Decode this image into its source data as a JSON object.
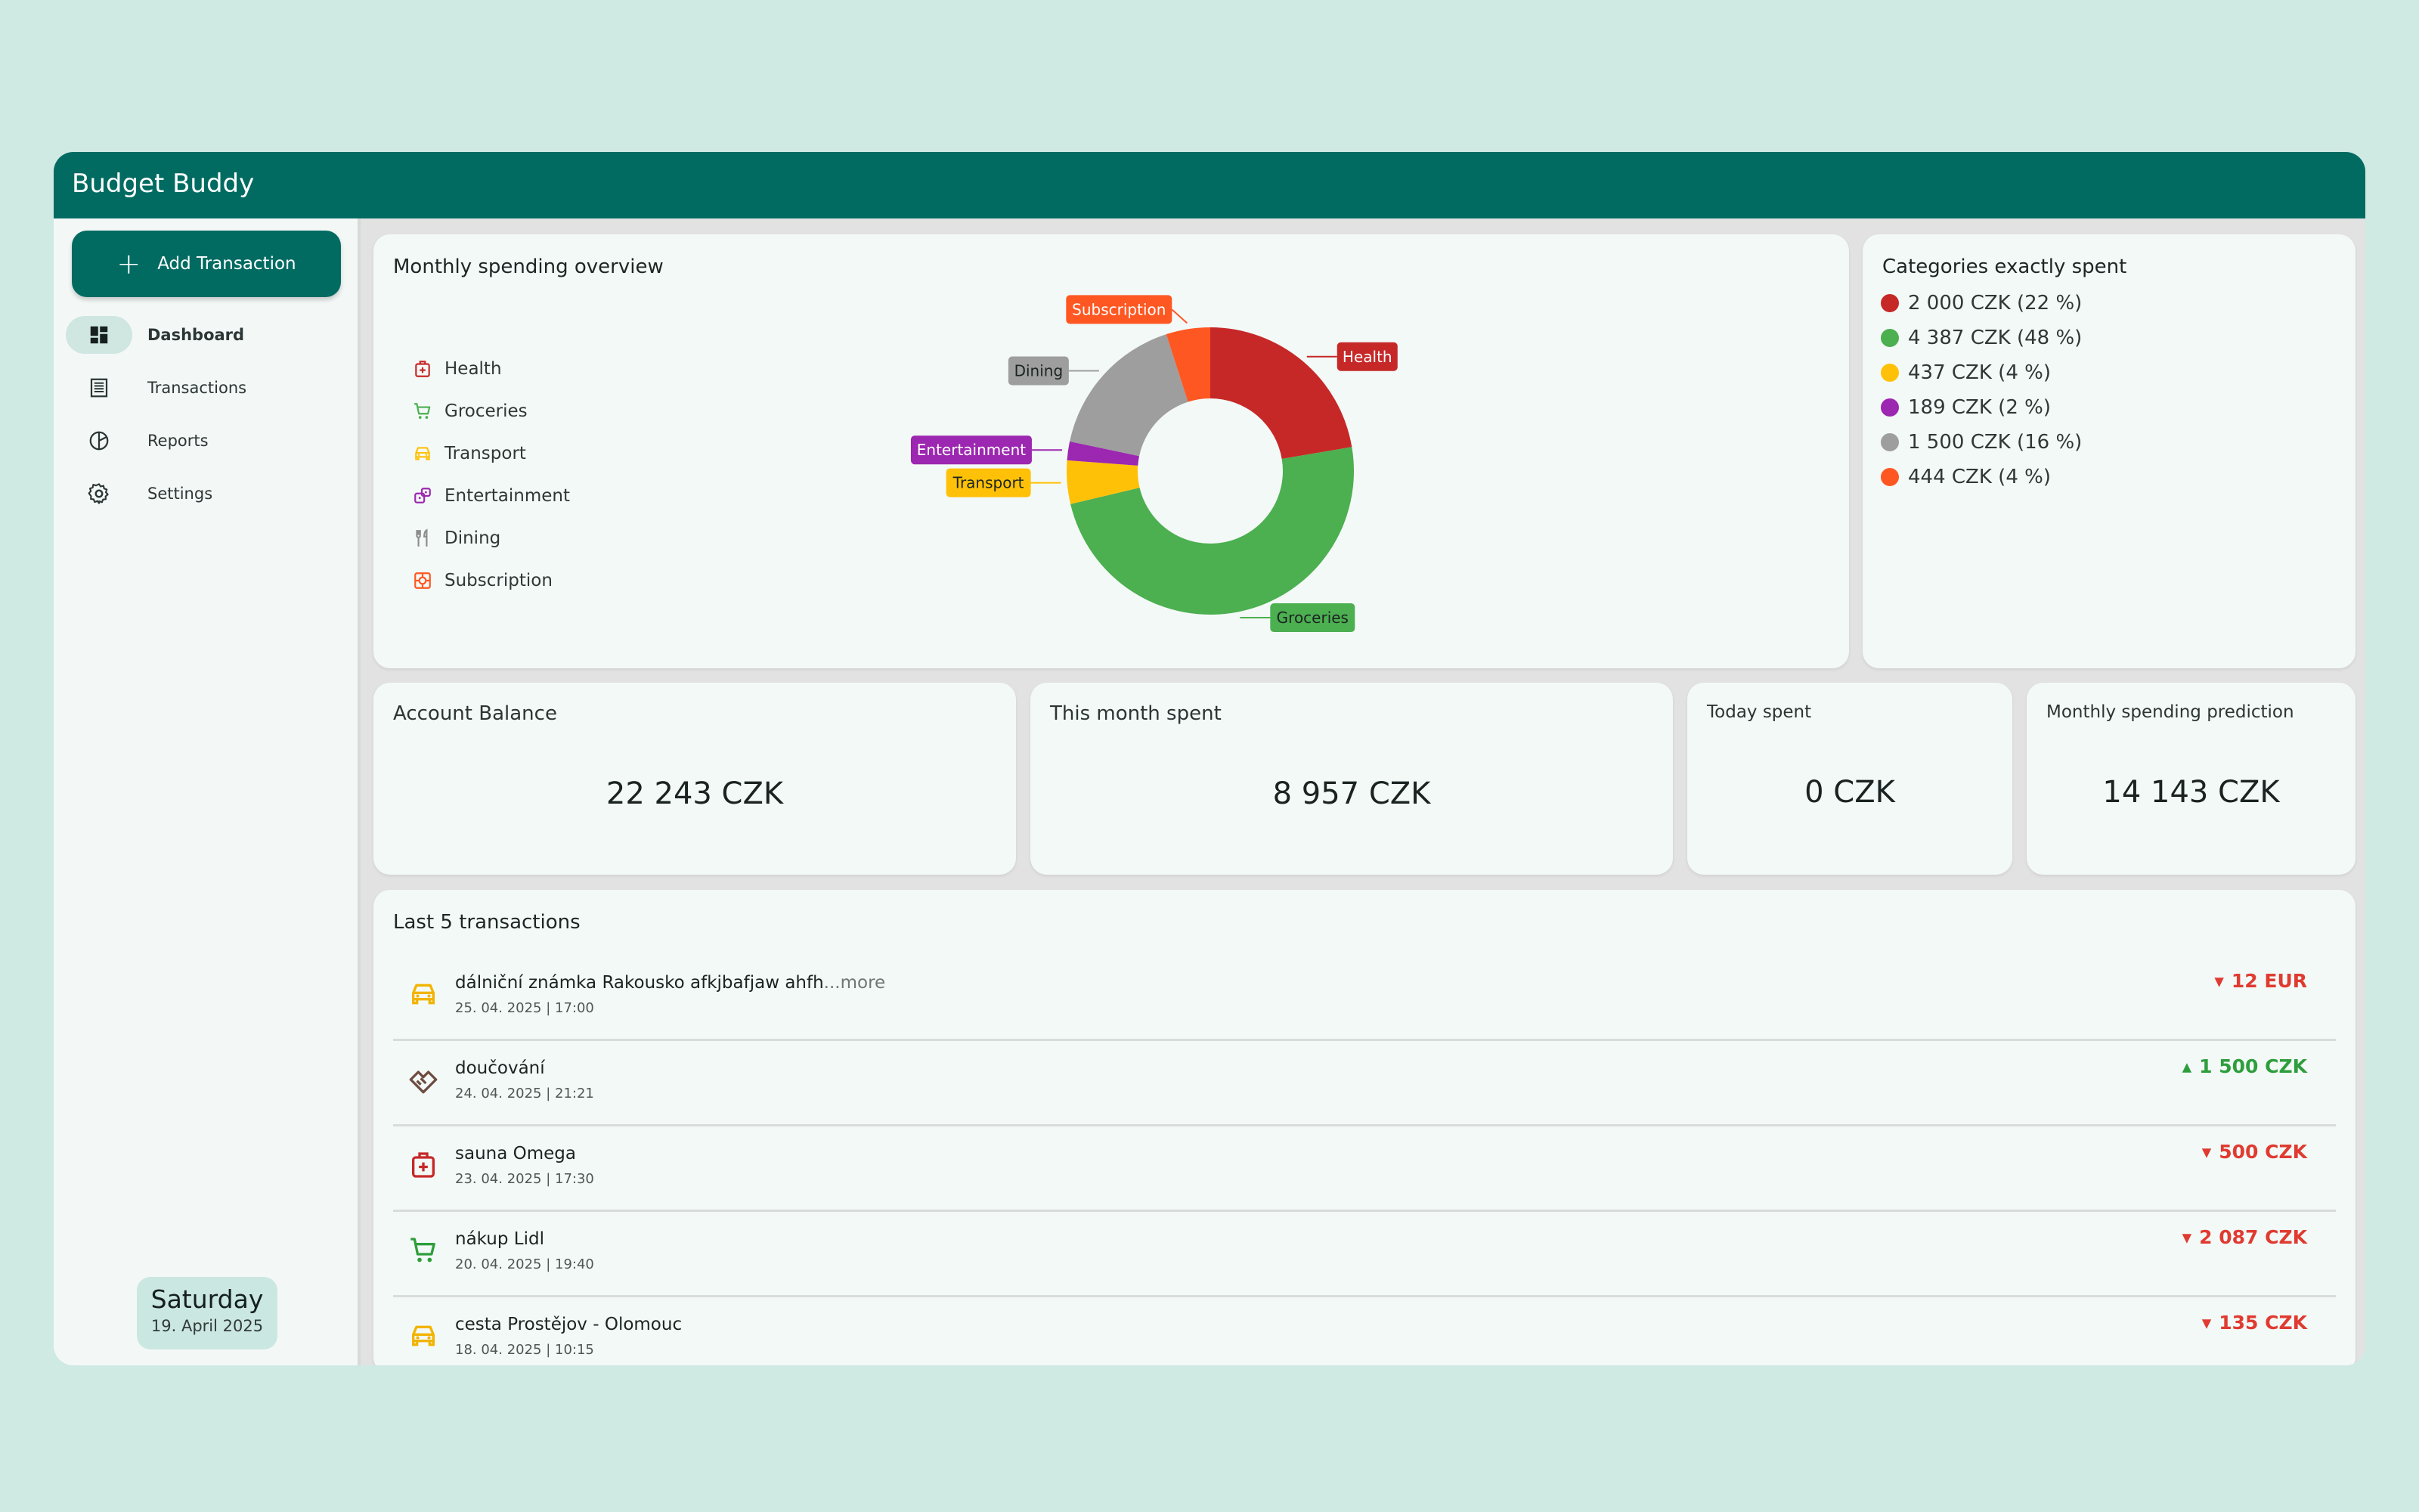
{
  "app": {
    "title": "Budget Buddy"
  },
  "sidebar": {
    "add_label": "Add Transaction",
    "items": [
      {
        "label": "Dashboard",
        "icon": "dashboard-icon",
        "active": true
      },
      {
        "label": "Transactions",
        "icon": "list-icon",
        "active": false
      },
      {
        "label": "Reports",
        "icon": "pie-chart-icon",
        "active": false
      },
      {
        "label": "Settings",
        "icon": "gear-icon",
        "active": false
      }
    ],
    "date": {
      "day": "Saturday",
      "date": "19. April 2025"
    }
  },
  "overview": {
    "title": "Monthly spending overview",
    "legend": [
      {
        "label": "Health",
        "icon": "medical-bag-icon",
        "color": "#c62828"
      },
      {
        "label": "Groceries",
        "icon": "cart-icon",
        "color": "#4caf50"
      },
      {
        "label": "Transport",
        "icon": "car-icon",
        "color": "#ffc107"
      },
      {
        "label": "Entertainment",
        "icon": "gamepad-icon",
        "color": "#9c27b0"
      },
      {
        "label": "Dining",
        "icon": "fork-knife-icon",
        "color": "#9e9e9e"
      },
      {
        "label": "Subscription",
        "icon": "subscription-icon",
        "color": "#ff5722"
      }
    ]
  },
  "chart_data": {
    "type": "pie",
    "donut": true,
    "title": "Monthly spending overview",
    "categories": [
      "Health",
      "Groceries",
      "Transport",
      "Entertainment",
      "Dining",
      "Subscription"
    ],
    "values": [
      2000,
      4387,
      437,
      189,
      1500,
      444
    ],
    "colors": [
      "#c62828",
      "#4caf50",
      "#ffc107",
      "#9c27b0",
      "#9e9e9e",
      "#ff5722"
    ]
  },
  "categories_card": {
    "title": "Categories exactly spent",
    "rows": [
      {
        "text": "2 000 CZK (22 %)",
        "color": "#c62828"
      },
      {
        "text": "4 387 CZK (48 %)",
        "color": "#4caf50"
      },
      {
        "text": "437 CZK (4 %)",
        "color": "#ffc107"
      },
      {
        "text": "189 CZK (2 %)",
        "color": "#9c27b0"
      },
      {
        "text": "1 500 CZK (16 %)",
        "color": "#9e9e9e"
      },
      {
        "text": "444 CZK (4 %)",
        "color": "#ff5722"
      }
    ]
  },
  "stats": {
    "balance": {
      "label": "Account Balance",
      "value": "22 243 CZK"
    },
    "month": {
      "label": "This month spent",
      "value": "8 957 CZK"
    },
    "today": {
      "label": "Today spent",
      "value": "0 CZK"
    },
    "prediction": {
      "label": "Monthly spending prediction",
      "value": "14 143 CZK"
    }
  },
  "transactions": {
    "title": "Last 5 transactions",
    "rows": [
      {
        "name": "dálniční známka Rakousko afkjbafjaw ahfh",
        "more": "...more",
        "date": "25. 04. 2025 | 17:00",
        "amount": "12 EUR",
        "dir": "down",
        "icon": "car-icon",
        "color": "#f2b400"
      },
      {
        "name": "doučování",
        "more": "",
        "date": "24. 04. 2025 | 21:21",
        "amount": "1 500 CZK",
        "dir": "up",
        "icon": "handshake-icon",
        "color": "#6d4c41"
      },
      {
        "name": "sauna Omega",
        "more": "",
        "date": "23. 04. 2025 | 17:30",
        "amount": "500 CZK",
        "dir": "down",
        "icon": "medical-bag-icon",
        "color": "#c62828"
      },
      {
        "name": "nákup Lidl",
        "more": "",
        "date": "20. 04. 2025 | 19:40",
        "amount": "2 087 CZK",
        "dir": "down",
        "icon": "cart-icon",
        "color": "#2e9e3d"
      },
      {
        "name": "cesta Prostějov - Olomouc",
        "more": "",
        "date": "18. 04. 2025 | 10:15",
        "amount": "135 CZK",
        "dir": "down",
        "icon": "car-icon",
        "color": "#f2b400"
      }
    ]
  }
}
